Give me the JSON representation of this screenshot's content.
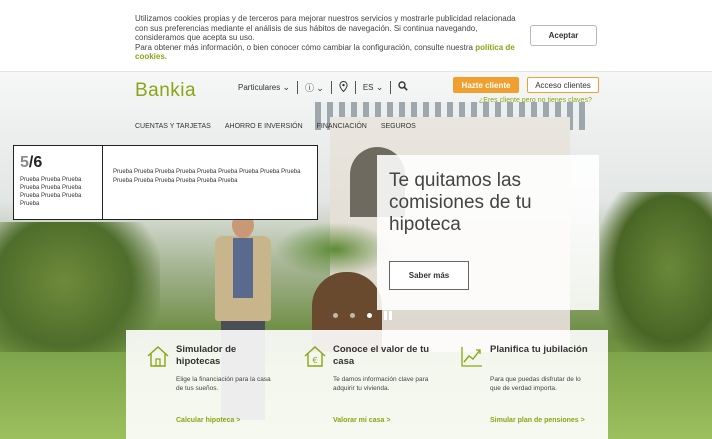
{
  "cookie": {
    "line1": "Utilizamos cookies propias y de terceros para mejorar nuestros servicios y mostrarle publicidad relacionada",
    "line2": "con sus preferencias mediante el análisis de sus hábitos de navegación. Si continua navegando,",
    "line3": "consideramos que acepta su uso.",
    "line4": "Para obtener más información, o bien conocer cómo cambiar la configuración, consulte nuestra",
    "link": "política de cookies.",
    "accept_label": "Aceptar"
  },
  "header": {
    "logo": "Bankia",
    "segment": "Particulares",
    "language": "ES",
    "hazte_cliente": "Hazte cliente",
    "acceso_clientes": "Acceso clientes",
    "eres_cliente": "¿Eres cliente pero no tienes claves?",
    "menu": [
      "CUENTAS Y TARJETAS",
      "AHORRO E INVERSIÓN",
      "FINANCIACIÓN",
      "SEGUROS"
    ]
  },
  "slider": {
    "current": "5",
    "total": "/6",
    "counter_text": "Prueba Prueba Prueba Prueba Prueba Prueba Prueba Prueba Prueba Prueba",
    "box_text": "Prueba Prueba Prueba Prueba Prueba Prueba Prueba Prueba Prueba Prueba Prueba Prueba Prueba Prueba Prueba",
    "active_slide": 3
  },
  "promo": {
    "title": "Te quitamos las comisiones de tu hipoteca",
    "button": "Saber más"
  },
  "cards": [
    {
      "title": "Simulador de hipotecas",
      "desc": "Elige la financiación para la casa de tus sueños.",
      "link": "Calcular hipoteca >",
      "icon": "house-icon"
    },
    {
      "title": "Conoce el valor de tu casa",
      "desc": "Te damos información clave para adquirir tu vivienda.",
      "link": "Valorar mi casa >",
      "icon": "house-euro-icon"
    },
    {
      "title": "Planifica tu jubilación",
      "desc": "Para que puedas disfrutar de lo que de verdad importa.",
      "link": "Simular plan de pensiones >",
      "icon": "chart-growth-icon"
    }
  ],
  "colors": {
    "brand_green": "#8aa516",
    "accent_orange": "#f0a030"
  }
}
